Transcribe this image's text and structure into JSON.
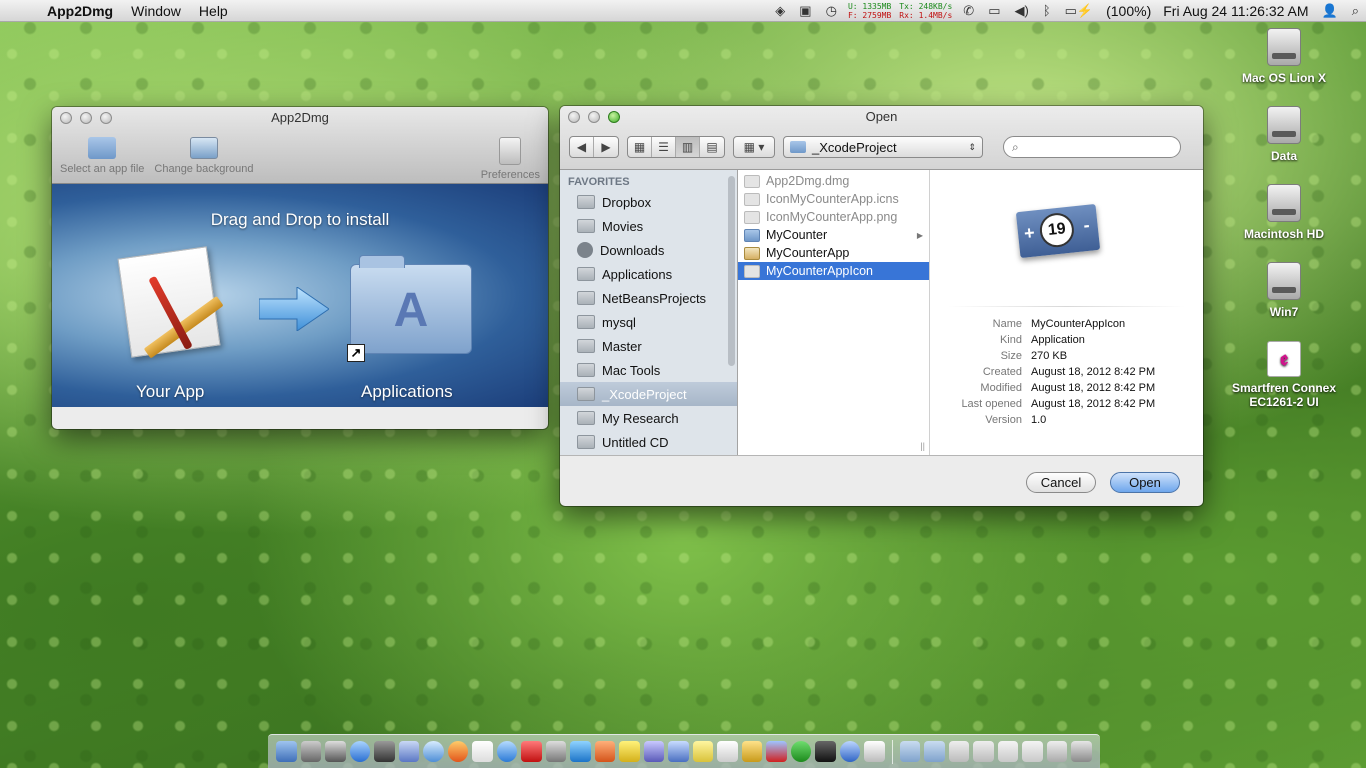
{
  "menubar": {
    "app_name": "App2Dmg",
    "menus": [
      "Window",
      "Help"
    ],
    "mem_u": "U: 1335MB",
    "mem_f": "F: 2759MB",
    "net_tx": "Tx:  248KB/s",
    "net_rx": "Rx:  1.4MB/s",
    "battery": "(100%)",
    "clock": "Fri Aug 24   11:26:32 AM"
  },
  "app2dmg": {
    "title": "App2Dmg",
    "toolbar": {
      "select_label": "Select an app file",
      "change_bg_label": "Change background",
      "preferences_label": "Preferences"
    },
    "install_title": "Drag and Drop to install",
    "your_app_label": "Your App",
    "applications_label": "Applications"
  },
  "open_dialog": {
    "title": "Open",
    "location": "_XcodeProject",
    "search": {
      "placeholder": ""
    },
    "sidebar": {
      "heading": "FAVORITES",
      "items": [
        {
          "label": "Dropbox",
          "selected": false
        },
        {
          "label": "Movies",
          "selected": false
        },
        {
          "label": "Downloads",
          "selected": false
        },
        {
          "label": "Applications",
          "selected": false
        },
        {
          "label": "NetBeansProjects",
          "selected": false
        },
        {
          "label": "mysql",
          "selected": false
        },
        {
          "label": "Master",
          "selected": false
        },
        {
          "label": "Mac Tools",
          "selected": false
        },
        {
          "label": "_XcodeProject",
          "selected": true
        },
        {
          "label": "My Research",
          "selected": false
        },
        {
          "label": "Untitled CD",
          "selected": false
        }
      ]
    },
    "files": [
      {
        "name": "App2Dmg.dmg",
        "dim": true,
        "kind": "file"
      },
      {
        "name": "IconMyCounterApp.icns",
        "dim": true,
        "kind": "file"
      },
      {
        "name": "IconMyCounterApp.png",
        "dim": true,
        "kind": "file"
      },
      {
        "name": "MyCounter",
        "dim": false,
        "kind": "folder"
      },
      {
        "name": "MyCounterApp",
        "dim": false,
        "kind": "app"
      },
      {
        "name": "MyCounterAppIcon",
        "dim": false,
        "kind": "app",
        "selected": true
      }
    ],
    "preview": {
      "icon_number": "19",
      "info": [
        {
          "key": "Name",
          "value": "MyCounterAppIcon"
        },
        {
          "key": "Kind",
          "value": "Application"
        },
        {
          "key": "Size",
          "value": "270 KB"
        },
        {
          "key": "Created",
          "value": "August 18, 2012 8:42 PM"
        },
        {
          "key": "Modified",
          "value": "August 18, 2012 8:42 PM"
        },
        {
          "key": "Last opened",
          "value": "August 18, 2012 8:42 PM"
        },
        {
          "key": "Version",
          "value": "1.0"
        }
      ]
    },
    "buttons": {
      "cancel": "Cancel",
      "open": "Open"
    }
  },
  "desktop_icons": [
    {
      "label": "Mac OS Lion X",
      "type": "hd"
    },
    {
      "label": "Data",
      "type": "hd"
    },
    {
      "label": "Macintosh HD",
      "type": "hd"
    },
    {
      "label": "Win7",
      "type": "hd"
    },
    {
      "label": "Smartfren Connex EC1261-2 UI",
      "type": "app"
    }
  ],
  "colors": {
    "selection_blue": "#3875d7",
    "sidebar_bg": "#dee4ea",
    "install_bg": "#2f5f9a"
  }
}
